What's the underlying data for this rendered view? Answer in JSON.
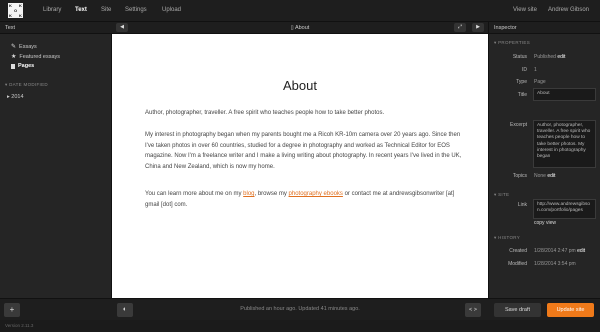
{
  "logo": {
    "letters": [
      "K",
      "",
      "K",
      "",
      "O",
      "",
      "K",
      "",
      "K"
    ]
  },
  "nav": {
    "library": "Library",
    "text": "Text",
    "site": "Site",
    "settings": "Settings",
    "upload": "Upload"
  },
  "topright": {
    "view_site": "View site",
    "user": "Andrew Gibson"
  },
  "sidebar": {
    "title": "Text",
    "items": [
      {
        "label": "Essays"
      },
      {
        "label": "Featured essays"
      },
      {
        "label": "Pages"
      }
    ],
    "date_section": "▾ DATE MODIFIED",
    "years": [
      {
        "label": "▸ 2014"
      }
    ]
  },
  "center": {
    "title": "About"
  },
  "document": {
    "heading": "About",
    "p1": "Author, photographer, traveller. A free spirit who teaches people how to take better photos.",
    "p2": "My interest in photography began when my parents bought me a Ricoh KR-10m camera over 20 years ago. Since then I've taken photos in over 60 countries, studied for a degree in photography and worked as Technical Editor for EOS magazine. Now I'm a freelance writer and I make a living writing about photography. In recent years I've lived in the UK, China and New Zealand, which is now my home.",
    "p3_a": "You can learn more about me on my ",
    "p3_link1": "blog",
    "p3_b": ", browse my ",
    "p3_link2": "photography ebooks",
    "p3_c": " or contact me at andrewsgibsonwriter [at] gmail [dot] com."
  },
  "inspector": {
    "title": "Inspector",
    "sec_properties": "▾ PROPERTIES",
    "status_label": "Status",
    "status_value": "Published",
    "status_edit": "edit",
    "id_label": "ID",
    "id_value": "1",
    "type_label": "Type",
    "type_value": "Page",
    "title_label": "Title",
    "title_value": "About",
    "excerpt_label": "Excerpt",
    "excerpt_value": "Author, photographer, traveller. A free spirit who teaches people how to take better photos. My interest in photography began",
    "topics_label": "Topics",
    "topics_value": "None",
    "topics_edit": "edit",
    "sec_site": "▾ SITE",
    "link_label": "Link",
    "link_value": "http://www.andrewsgibson.com/portfolio/pages",
    "link_copy": "copy",
    "link_view": "view",
    "sec_history": "▾ HISTORY",
    "created_label": "Created",
    "created_value": "1/28/2014 2:47 pm",
    "created_edit": "edit",
    "modified_label": "Modified",
    "modified_value": "1/28/2014 3:54 pm"
  },
  "bottom": {
    "add": "+",
    "status": "Published an hour ago. Updated 41 minutes ago.",
    "code": "< >",
    "save_draft": "Save draft",
    "update_site": "Update site",
    "version": "Version 2.11.3"
  }
}
